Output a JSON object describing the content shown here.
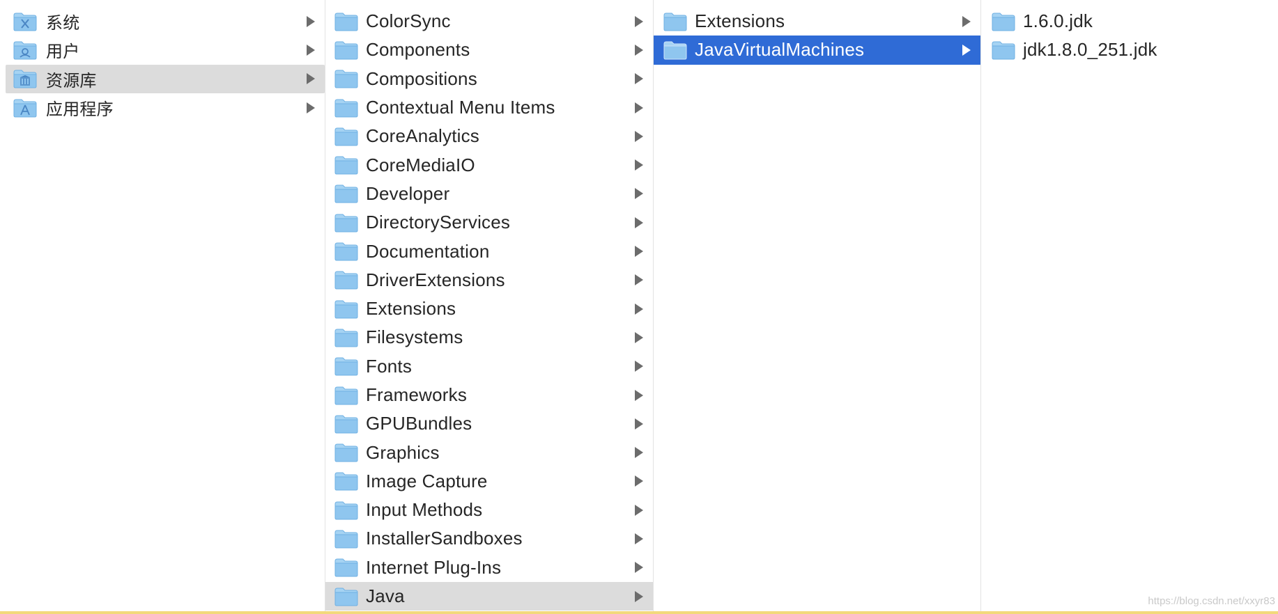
{
  "colors": {
    "selected_active": "#2f6bd6",
    "selected_inactive": "#dcdcdc",
    "folder_fill": "#8fc6ef",
    "chevron": "#6c6c6c",
    "bottom_bar": "#f2d97c"
  },
  "columns": [
    {
      "items": [
        {
          "label": "系统",
          "icon": "system-folder-icon",
          "has_children": true,
          "state": "normal"
        },
        {
          "label": "用户",
          "icon": "users-folder-icon",
          "has_children": true,
          "state": "normal"
        },
        {
          "label": "资源库",
          "icon": "library-folder-icon",
          "has_children": true,
          "state": "selected-inactive"
        },
        {
          "label": "应用程序",
          "icon": "applications-folder-icon",
          "has_children": true,
          "state": "normal"
        }
      ]
    },
    {
      "items": [
        {
          "label": "ColorSync",
          "has_children": true,
          "state": "normal"
        },
        {
          "label": "Components",
          "has_children": true,
          "state": "normal"
        },
        {
          "label": "Compositions",
          "has_children": true,
          "state": "normal"
        },
        {
          "label": "Contextual Menu Items",
          "has_children": true,
          "state": "normal"
        },
        {
          "label": "CoreAnalytics",
          "has_children": true,
          "state": "normal"
        },
        {
          "label": "CoreMediaIO",
          "has_children": true,
          "state": "normal"
        },
        {
          "label": "Developer",
          "has_children": true,
          "state": "normal"
        },
        {
          "label": "DirectoryServices",
          "has_children": true,
          "state": "normal"
        },
        {
          "label": "Documentation",
          "has_children": true,
          "state": "normal"
        },
        {
          "label": "DriverExtensions",
          "has_children": true,
          "state": "normal"
        },
        {
          "label": "Extensions",
          "has_children": true,
          "state": "normal"
        },
        {
          "label": "Filesystems",
          "has_children": true,
          "state": "normal"
        },
        {
          "label": "Fonts",
          "has_children": true,
          "state": "normal"
        },
        {
          "label": "Frameworks",
          "has_children": true,
          "state": "normal"
        },
        {
          "label": "GPUBundles",
          "has_children": true,
          "state": "normal"
        },
        {
          "label": "Graphics",
          "has_children": true,
          "state": "normal"
        },
        {
          "label": "Image Capture",
          "has_children": true,
          "state": "normal"
        },
        {
          "label": "Input Methods",
          "has_children": true,
          "state": "normal"
        },
        {
          "label": "InstallerSandboxes",
          "has_children": true,
          "state": "normal"
        },
        {
          "label": "Internet Plug-Ins",
          "has_children": true,
          "state": "normal"
        },
        {
          "label": "Java",
          "has_children": true,
          "state": "selected-inactive"
        }
      ]
    },
    {
      "items": [
        {
          "label": "Extensions",
          "has_children": true,
          "state": "normal"
        },
        {
          "label": "JavaVirtualMachines",
          "has_children": true,
          "state": "selected-active"
        }
      ]
    },
    {
      "items": [
        {
          "label": "1.6.0.jdk",
          "has_children": false,
          "state": "normal"
        },
        {
          "label": "jdk1.8.0_251.jdk",
          "has_children": false,
          "state": "normal"
        }
      ]
    }
  ],
  "watermark": "https://blog.csdn.net/xxyr83"
}
